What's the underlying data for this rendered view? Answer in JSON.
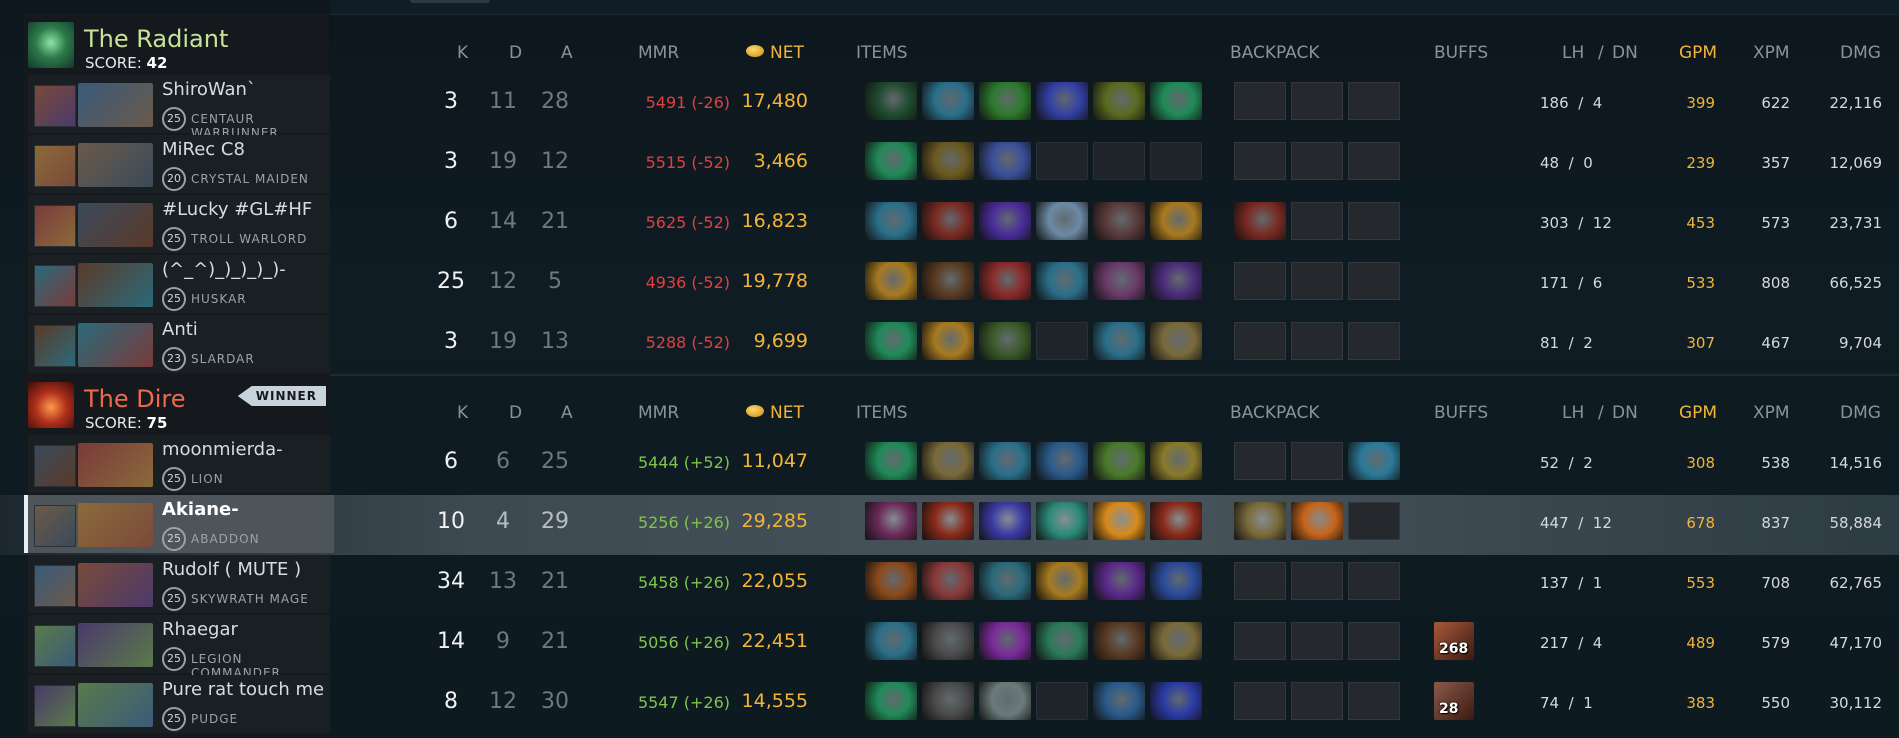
{
  "columns": {
    "k": "K",
    "d": "D",
    "a": "A",
    "mmr": "MMR",
    "net": "NET",
    "items": "ITEMS",
    "backpack": "BACKPACK",
    "buffs": "BUFFS",
    "lh": "LH",
    "slash": "/",
    "dn": "DN",
    "gpm": "GPM",
    "xpm": "XPM",
    "dmg": "DMG"
  },
  "colors": {
    "gold": "#f2b43a",
    "mmr_loss": "#e04040",
    "mmr_gain": "#7fc44d",
    "radiant": "#c6e39a",
    "dire": "#ef6a4a"
  },
  "radiant": {
    "name": "The Radiant",
    "score_label": "SCORE:",
    "score": "42",
    "players": [
      {
        "name": "ShiroWan`",
        "level": "25",
        "hero": "CENTAUR WARRUNNER",
        "k": "3",
        "d": "11",
        "a": "28",
        "mmr": "5491 (-26)",
        "net": "17,480",
        "lh": "186",
        "dn": "4",
        "gpm": "399",
        "xpm": "622",
        "dmg": "22,116",
        "items": [
          "#1f4b2e",
          "#2a6f8a",
          "#2c7a2c",
          "#3340a5",
          "#5a6b1f",
          "#1f8a58"
        ],
        "backpack": [
          false,
          false,
          false
        ],
        "buff": null
      },
      {
        "name": "MiRec C8",
        "level": "20",
        "hero": "CRYSTAL MAIDEN",
        "k": "3",
        "d": "19",
        "a": "12",
        "mmr": "5515 (-52)",
        "net": "3,466",
        "lh": "48",
        "dn": "0",
        "gpm": "239",
        "xpm": "357",
        "dmg": "12,069",
        "items": [
          "#1f8a58",
          "#6b5a1f",
          "#3a4f9a",
          null,
          null,
          null
        ],
        "backpack": [
          false,
          false,
          false
        ],
        "buff": null
      },
      {
        "name": "#Lucky #GL#HF",
        "level": "25",
        "hero": "TROLL WARLORD",
        "k": "6",
        "d": "14",
        "a": "21",
        "mmr": "5625 (-52)",
        "net": "16,823",
        "lh": "303",
        "dn": "12",
        "gpm": "453",
        "xpm": "573",
        "dmg": "23,731",
        "items": [
          "#2a6f8a",
          "#7a2a22",
          "#4a2c9a",
          "#6c8aa5",
          "#5a3a3a",
          "#a87a1f"
        ],
        "backpack": [
          "#7a2a22",
          false,
          false
        ],
        "buff": null
      },
      {
        "name": "(^_^)_)_)_)_)-",
        "level": "25",
        "hero": "HUSKAR",
        "k": "25",
        "d": "12",
        "a": "5",
        "mmr": "4936 (-52)",
        "net": "19,778",
        "lh": "171",
        "dn": "6",
        "gpm": "533",
        "xpm": "808",
        "dmg": "66,525",
        "items": [
          "#a87a1f",
          "#5a3a22",
          "#8a2a2a",
          "#2a6f8a",
          "#6a3a6a",
          "#4a2c7a"
        ],
        "backpack": [
          false,
          false,
          false
        ],
        "buff": null
      },
      {
        "name": "Anti",
        "level": "23",
        "hero": "SLARDAR",
        "k": "3",
        "d": "19",
        "a": "13",
        "mmr": "5288 (-52)",
        "net": "9,699",
        "lh": "81",
        "dn": "2",
        "gpm": "307",
        "xpm": "467",
        "dmg": "9,704",
        "items": [
          "#1f8a58",
          "#a87a1f",
          "#3a5a2a",
          null,
          "#2a6f8a",
          "#7a6a3a"
        ],
        "backpack": [
          false,
          false,
          false
        ],
        "buff": null
      }
    ]
  },
  "dire": {
    "name": "The Dire",
    "score_label": "SCORE:",
    "score": "75",
    "winner": "WINNER",
    "players": [
      {
        "name": "moonmierda-",
        "level": "25",
        "hero": "LION",
        "k": "6",
        "d": "6",
        "a": "25",
        "mmr": "5444 (+52)",
        "net": "11,047",
        "lh": "52",
        "dn": "2",
        "gpm": "308",
        "xpm": "538",
        "dmg": "14,516",
        "items": [
          "#1f8a58",
          "#7a6a3a",
          "#2a6f8a",
          "#2a5a8a",
          "#4a7a2a",
          "#8a7a2a"
        ],
        "backpack": [
          false,
          false,
          "#2a7a9a"
        ],
        "buff": null
      },
      {
        "name": "Akiane-",
        "level": "25",
        "hero": "ABADDON",
        "k": "10",
        "d": "4",
        "a": "29",
        "mmr": "5256 (+26)",
        "net": "29,285",
        "lh": "447",
        "dn": "12",
        "gpm": "678",
        "xpm": "837",
        "dmg": "58,884",
        "items": [
          "#6a2a5a",
          "#8a2a1a",
          "#3a3aa5",
          "#2a8a7a",
          "#d88a1a",
          "#8a2a1a"
        ],
        "backpack": [
          "#7a6a3a",
          "#c8641a",
          false
        ],
        "buff": null
      },
      {
        "name": "Rudolf ( MUTE )",
        "level": "25",
        "hero": "SKYWRATH MAGE",
        "k": "34",
        "d": "13",
        "a": "21",
        "mmr": "5458 (+26)",
        "net": "22,055",
        "lh": "137",
        "dn": "1",
        "gpm": "553",
        "xpm": "708",
        "dmg": "62,765",
        "items": [
          "#8a4a1a",
          "#8a3a3a",
          "#2a6a7a",
          "#a87a1f",
          "#5a2a8a",
          "#2a4a9a"
        ],
        "backpack": [
          false,
          false,
          false
        ],
        "buff": null
      },
      {
        "name": "Rhaegar",
        "level": "25",
        "hero": "LEGION COMMANDER",
        "k": "14",
        "d": "9",
        "a": "21",
        "mmr": "5056 (+26)",
        "net": "22,451",
        "lh": "217",
        "dn": "4",
        "gpm": "489",
        "xpm": "579",
        "dmg": "47,170",
        "items": [
          "#2a6f8a",
          "#4a4a4a",
          "#7a2a9a",
          "#2a7a5a",
          "#5a3a22",
          "#7a6a3a"
        ],
        "backpack": [
          false,
          false,
          false
        ],
        "buff": {
          "color": "#a85a3a",
          "value": "268"
        }
      },
      {
        "name": "Pure rat touch me",
        "level": "25",
        "hero": "PUDGE",
        "k": "8",
        "d": "12",
        "a": "30",
        "mmr": "5547 (+26)",
        "net": "14,555",
        "lh": "74",
        "dn": "1",
        "gpm": "383",
        "xpm": "550",
        "dmg": "30,112",
        "items": [
          "#1f8a58",
          "#4a4a4a",
          "#6a7a7a",
          null,
          "#2a5a8a",
          "#2a3aa5"
        ],
        "backpack": [
          false,
          false,
          false
        ],
        "buff": {
          "color": "#8a5a4a",
          "value": "28"
        }
      }
    ]
  }
}
